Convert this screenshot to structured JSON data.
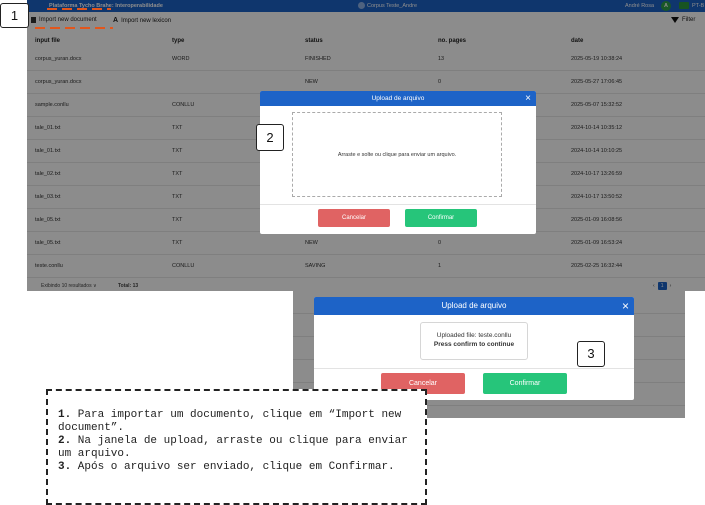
{
  "app": {
    "brand": "Plataforma Tycho Brahe: Interoperabilidade",
    "corpus": "Corpus Teste_Andre",
    "user": "André Rosa",
    "avatar_letter": "A",
    "language": "PT-B"
  },
  "toolbar": {
    "import_document": "Import new document",
    "import_lexicon": "Import new lexicon",
    "filter": "Filter"
  },
  "table": {
    "columns": [
      "input file",
      "type",
      "status",
      "no. pages",
      "date"
    ],
    "rows": [
      {
        "file": "corpus_yuran.docx",
        "type": "WORD",
        "status": "FINISHED",
        "pages": "13",
        "date": "2025-05-19 10:38:24"
      },
      {
        "file": "corpus_yuran.docx",
        "type": "",
        "status": "NEW",
        "pages": "0",
        "date": "2025-05-27 17:06:45"
      },
      {
        "file": "sample.conllu",
        "type": "CONLLU",
        "status": "",
        "pages": "",
        "date": "2025-05-07 15:32:52"
      },
      {
        "file": "tale_01.txt",
        "type": "TXT",
        "status": "",
        "pages": "",
        "date": "2024-10-14 10:35:12"
      },
      {
        "file": "tale_01.txt",
        "type": "TXT",
        "status": "",
        "pages": "",
        "date": "2024-10-14 10:10:25"
      },
      {
        "file": "tale_02.txt",
        "type": "TXT",
        "status": "",
        "pages": "",
        "date": "2024-10-17 13:26:59"
      },
      {
        "file": "tale_03.txt",
        "type": "TXT",
        "status": "",
        "pages": "",
        "date": "2024-10-17 13:50:52"
      },
      {
        "file": "tale_05.txt",
        "type": "TXT",
        "status": "",
        "pages": "",
        "date": "2025-01-09 16:08:56"
      },
      {
        "file": "tale_05.txt",
        "type": "TXT",
        "status": "NEW",
        "pages": "0",
        "date": "2025-01-09 16:53:24"
      },
      {
        "file": "teste.conllu",
        "type": "CONLLU",
        "status": "SAVING",
        "pages": "1",
        "date": "2025-02-25 16:32:44"
      }
    ],
    "shown": "Exibindo 10 resultados ∨",
    "total": "Total: 13",
    "current_page": "1"
  },
  "modal1": {
    "title": "Upload de arquivo",
    "dropzone": "Arraste e solte ou clique para enviar um arquivo.",
    "cancel": "Cancelar",
    "confirm": "Confirmar"
  },
  "modal2": {
    "title": "Upload de arquivo",
    "uploaded": "Uploaded file: teste.conllu",
    "press": "Press confirm to continue",
    "cancel": "Cancelar",
    "confirm": "Confirmar",
    "bg_cell_d": "D",
    "bg_cell_1": "1"
  },
  "callouts": {
    "one": "1",
    "two": "2",
    "three": "3"
  },
  "instructions": {
    "n1": "1.",
    "s1": " Para importar um documento, clique em “Import new document”.",
    "n2": "2.",
    "s2": " Na janela de upload, arraste ou clique para enviar um arquivo.",
    "n3": "3.",
    "s3": " Após o arquivo ser enviado, clique em Confirmar."
  },
  "colors": {
    "primary": "#1d63c7",
    "danger": "#e06363",
    "success": "#26c57a",
    "highlight": "#e2561c"
  }
}
